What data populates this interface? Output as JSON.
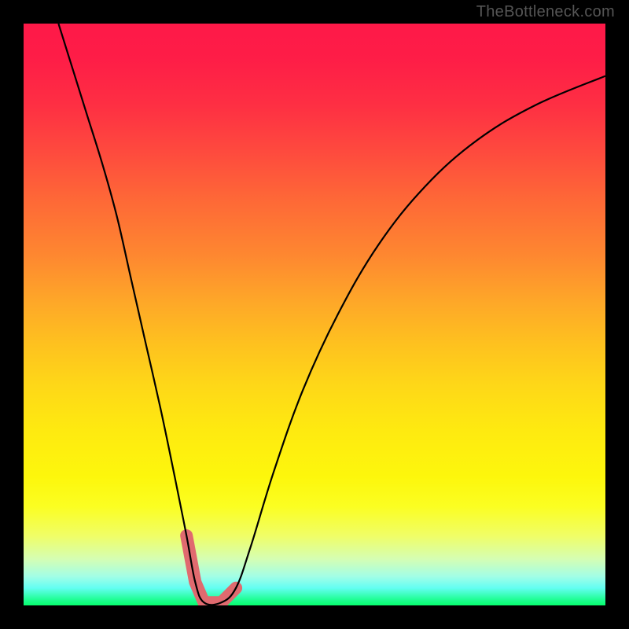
{
  "watermark": "TheBottleneck.com",
  "chart_data": {
    "type": "line",
    "title": "",
    "xlabel": "",
    "ylabel": "",
    "xlim": [
      0,
      1
    ],
    "ylim": [
      0,
      1
    ],
    "min_x": 0.3,
    "curve": [
      {
        "x": 0.06,
        "y": 1.0
      },
      {
        "x": 0.085,
        "y": 0.92
      },
      {
        "x": 0.11,
        "y": 0.84
      },
      {
        "x": 0.135,
        "y": 0.76
      },
      {
        "x": 0.16,
        "y": 0.67
      },
      {
        "x": 0.185,
        "y": 0.56
      },
      {
        "x": 0.21,
        "y": 0.45
      },
      {
        "x": 0.235,
        "y": 0.34
      },
      {
        "x": 0.26,
        "y": 0.22
      },
      {
        "x": 0.28,
        "y": 0.12
      },
      {
        "x": 0.295,
        "y": 0.04
      },
      {
        "x": 0.31,
        "y": 0.005
      },
      {
        "x": 0.34,
        "y": 0.005
      },
      {
        "x": 0.365,
        "y": 0.03
      },
      {
        "x": 0.39,
        "y": 0.1
      },
      {
        "x": 0.43,
        "y": 0.23
      },
      {
        "x": 0.48,
        "y": 0.37
      },
      {
        "x": 0.54,
        "y": 0.5
      },
      {
        "x": 0.61,
        "y": 0.62
      },
      {
        "x": 0.69,
        "y": 0.72
      },
      {
        "x": 0.78,
        "y": 0.8
      },
      {
        "x": 0.88,
        "y": 0.86
      },
      {
        "x": 1.0,
        "y": 0.91
      }
    ],
    "marker_range": {
      "x_start": 0.275,
      "x_end": 0.37
    },
    "colors": {
      "curve": "#000000",
      "marker": "#e06a6f",
      "frame": "#000000"
    }
  }
}
